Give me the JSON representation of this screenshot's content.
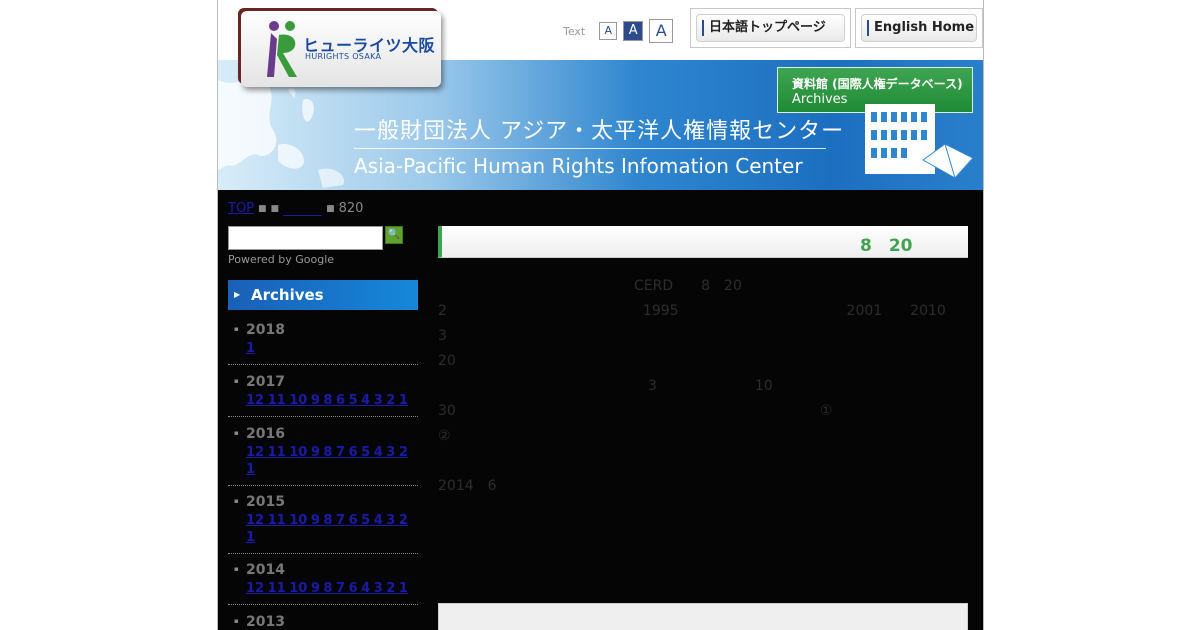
{
  "header": {
    "logo_jp": "ヒューライツ大阪",
    "logo_en": "HURIGHTS OSAKA",
    "text_label": "Text",
    "size_small": "A",
    "size_medium": "A",
    "size_large": "A",
    "japanese_top": "日本語トップページ",
    "english_home": "English Home"
  },
  "banner": {
    "title_jp": "一般財団法人 アジア・太平洋人権情報センター",
    "title_en": "Asia-Pacific Human Rights Infomation Center",
    "archive_jp": "資料館 (国際人権データベース)",
    "archive_en": "Archives"
  },
  "breadcrumb": {
    "top": "TOP",
    "sep1": "■",
    "sep2": "■",
    "category": "　　　",
    "sep3": "■",
    "current": "820"
  },
  "sidebar": {
    "powered": "Powered by Google",
    "search_button": "🔍",
    "archives_title": "Archives",
    "years": [
      {
        "year": "2018",
        "months": "1"
      },
      {
        "year": "2017",
        "months": "12 11 10 9 8 6 5 4 3 2 1"
      },
      {
        "year": "2016",
        "months": "12 11 10 9 8 7 6 5 4 3 2 1"
      },
      {
        "year": "2015",
        "months": "12 11 10 9 8 7 6 5 4 3 2 1"
      },
      {
        "year": "2014",
        "months": "12 11 10 9 8 7 6 4 3 2 1"
      },
      {
        "year": "2013",
        "months": ""
      }
    ]
  },
  "article": {
    "title": "　　　　　　　　　　　　　　　　　　　　　　　　8　20　　",
    "paragraphs": [
      "　　　　　　　　　　　　　　CERD　　8　20　　　　　　　　　　　　　　　　　　　　　　　　　　　　　　　　　　　　　　2　　　　　　　　　　　　　　1995　　　　　　　　　　　　2001　　2010　　　　　　　　　3　　　　　　　　　　　　　　　　　　　　　　　　　　　　　　　　　　　　　　　　　　　　　　　　　　　　　　　　　20　　　　　　　　　　　　　　　　　　　　　　",
      "　　　　　　　　　　　　　　　3　　　　　　　10　　　　　　　　　　　　　　　　　　　　　　　　　　　　　　　　　　　　　　　　　　　　　　　　　　　　　　30　　　　　　　　　　　　　　　　　　　　　　　　　　①　　　　　　　　　　　　②　　　　　　　　　　　　　　　　　　　　　　　　　　　　　　　　　　　　　　　　　　　　　　　　　　　　　　　　　　　　　　　　　　　　　　　　　　　　　　　　　　　　　　　　　　　　　　　　　　　　　　　　　　　　　　　　　　　　　　　　　　　　　　　　　　　　　　　　　　　　　　　　　　　　",
      "　　　　　　　　　　　　　　　　　　　　　　　　　　　　　　　　　　　　　　　　　　　　　　　　　　　　　　2014　6　　　　　　　　　　　　　　　　　　　　　　　　　　　　　　　　　　　　　　　　　　　"
    ],
    "subheading": "　　　　　　　　　　"
  }
}
